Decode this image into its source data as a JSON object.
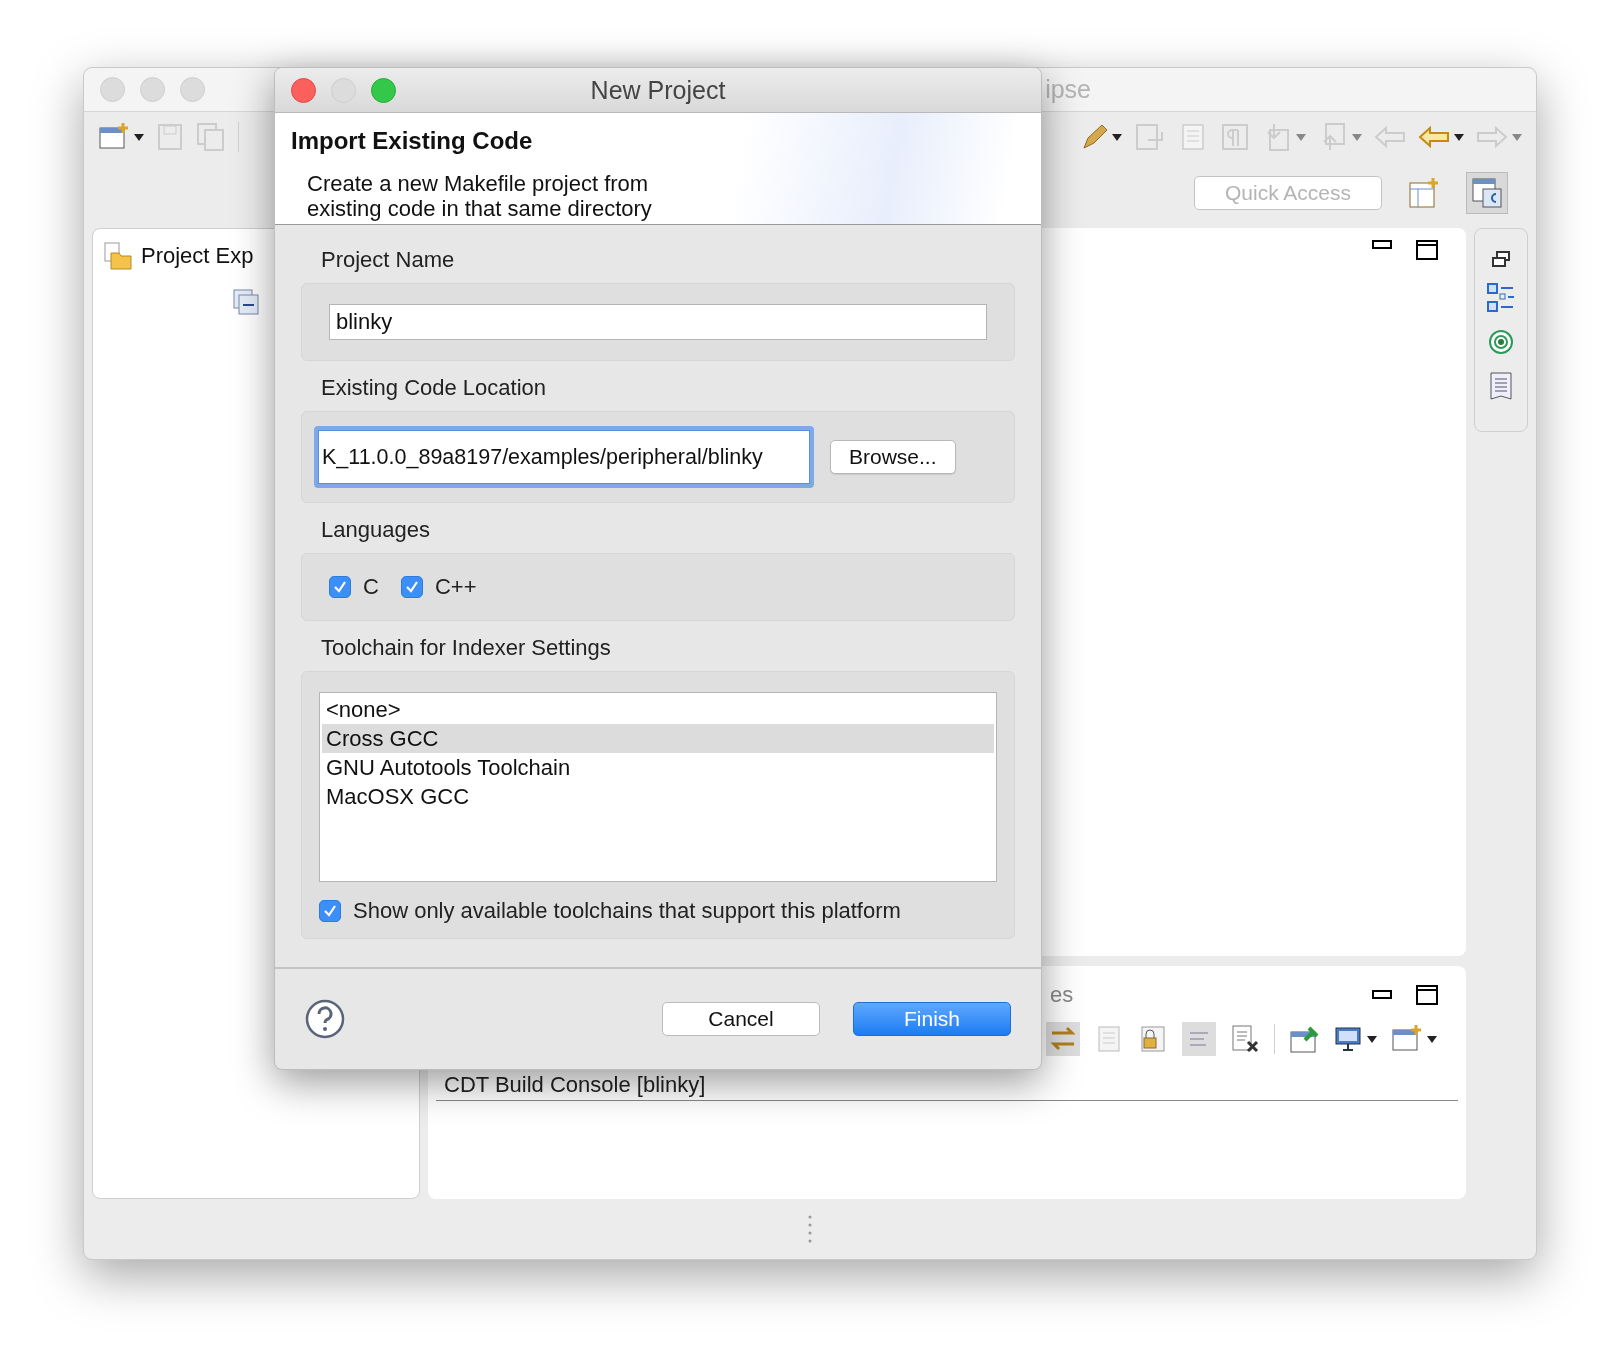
{
  "main_window": {
    "title": "ipse",
    "quick_access": {
      "placeholder": "Quick Access"
    },
    "project_explorer": {
      "title": "Project Exp"
    },
    "console": {
      "tab_fragment": "es",
      "console_name": "CDT Build Console [blinky]"
    }
  },
  "dialog": {
    "title": "New Project",
    "heading": "Import Existing Code",
    "description": "Create a new Makefile project from\nexisting code in that same directory",
    "project_name": {
      "label": "Project Name",
      "value": "blinky"
    },
    "code_location": {
      "label": "Existing Code Location",
      "value": "K_11.0.0_89a8197/examples/peripheral/blinky",
      "browse": "Browse..."
    },
    "languages": {
      "label": "Languages",
      "items": [
        {
          "label": "C",
          "checked": true
        },
        {
          "label": "C++",
          "checked": true
        }
      ]
    },
    "toolchain": {
      "label": "Toolchain for Indexer Settings",
      "items": [
        {
          "label": "<none>",
          "selected": false
        },
        {
          "label": "Cross GCC",
          "selected": true
        },
        {
          "label": "GNU Autotools Toolchain",
          "selected": false
        },
        {
          "label": "MacOSX GCC",
          "selected": false
        }
      ],
      "show_only": {
        "label": "Show only available toolchains that support this platform",
        "checked": true
      }
    },
    "buttons": [
      {
        "label": "Cancel",
        "kind": "secondary"
      },
      {
        "label": "Finish",
        "kind": "default"
      }
    ]
  }
}
